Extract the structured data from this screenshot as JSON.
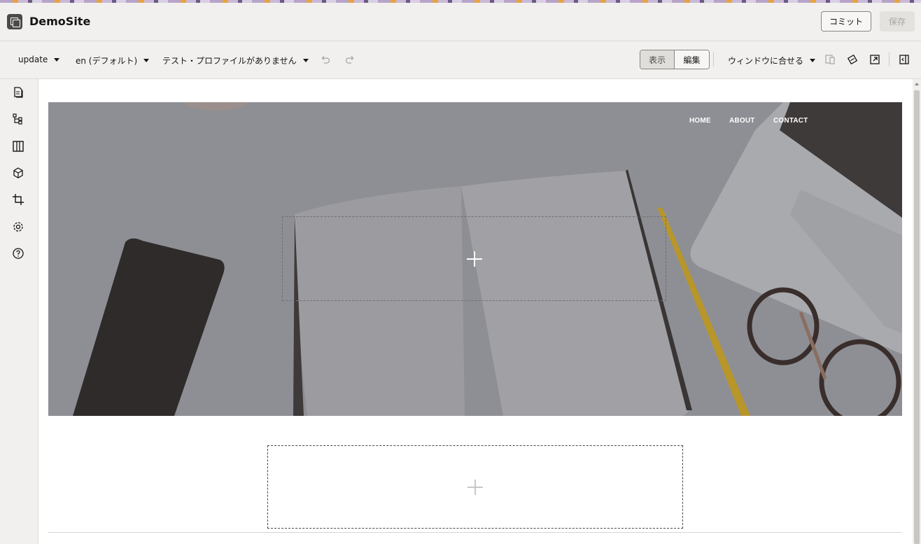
{
  "app": {
    "title": "DemoSite",
    "commit_label": "コミット",
    "save_label": "保存"
  },
  "toolbar": {
    "update_label": "update",
    "locale_label": "en (デフォルト)",
    "profile_label": "テスト・プロファイルがありません",
    "view_label": "表示",
    "edit_label": "編集",
    "fit_label": "ウィンドウに合せる"
  },
  "sidebar": {
    "items": [
      "pages-icon",
      "structure-icon",
      "columns-icon",
      "components-icon",
      "crop-icon",
      "settings-icon",
      "help-icon"
    ]
  },
  "hero": {
    "nav": [
      "HOME",
      "ABOUT",
      "CONTACT"
    ]
  },
  "colors": {
    "accent": "#161513",
    "hero_overlay": "#8c8e93",
    "pencil": "#d9a92a"
  }
}
